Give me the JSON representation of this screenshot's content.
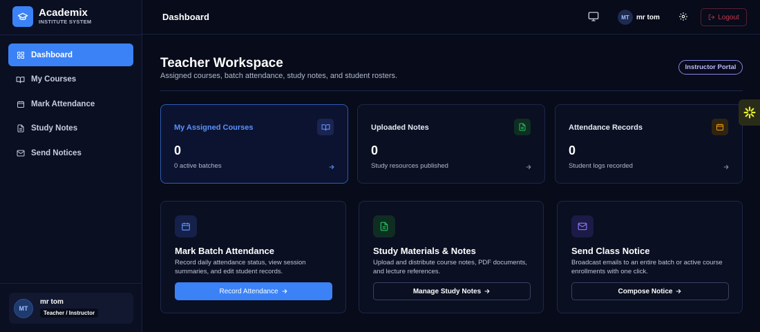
{
  "brand": {
    "name": "Academix",
    "subtitle": "INSTITUTE SYSTEM"
  },
  "sidebar": {
    "items": [
      {
        "label": "Dashboard",
        "icon": "dashboard-grid-icon",
        "active": true
      },
      {
        "label": "My Courses",
        "icon": "book-icon"
      },
      {
        "label": "Mark Attendance",
        "icon": "calendar-icon"
      },
      {
        "label": "Study Notes",
        "icon": "document-icon"
      },
      {
        "label": "Send Notices",
        "icon": "mail-icon"
      }
    ],
    "user": {
      "initials": "MT",
      "name": "mr tom",
      "role": "Teacher / Instructor"
    }
  },
  "header": {
    "title": "Dashboard",
    "user": {
      "initials": "MT",
      "name": "mr tom"
    },
    "logout_label": "Logout"
  },
  "main": {
    "title": "Teacher Workspace",
    "subtitle": "Assigned courses, batch attendance, study notes, and student rosters.",
    "portal_badge": "Instructor Portal",
    "stats": [
      {
        "title": "My Assigned Courses",
        "value": "0",
        "caption": "0 active batches",
        "icon": "book-icon",
        "color": "#5b92ff"
      },
      {
        "title": "Uploaded Notes",
        "value": "0",
        "caption": "Study resources published",
        "icon": "document-icon",
        "color": "#22c55e"
      },
      {
        "title": "Attendance Records",
        "value": "0",
        "caption": "Student logs recorded",
        "icon": "calendar-icon",
        "color": "#f59e0b"
      }
    ],
    "actions": [
      {
        "title": "Mark Batch Attendance",
        "description": "Record daily attendance status, view session summaries, and edit student records.",
        "button": "Record Attendance",
        "icon": "calendar-icon",
        "color": "#5b92ff"
      },
      {
        "title": "Study Materials & Notes",
        "description": "Upload and distribute course notes, PDF documents, and lecture references.",
        "button": "Manage Study Notes",
        "icon": "document-icon",
        "color": "#22c55e"
      },
      {
        "title": "Send Class Notice",
        "description": "Broadcast emails to an entire batch or active course enrollments with one click.",
        "button": "Compose Notice",
        "icon": "mail-icon",
        "color": "#8b7cf6"
      }
    ]
  },
  "colors": {
    "accent": "#3b82f6",
    "background": "#070b1a",
    "danger": "#c23a4f"
  }
}
